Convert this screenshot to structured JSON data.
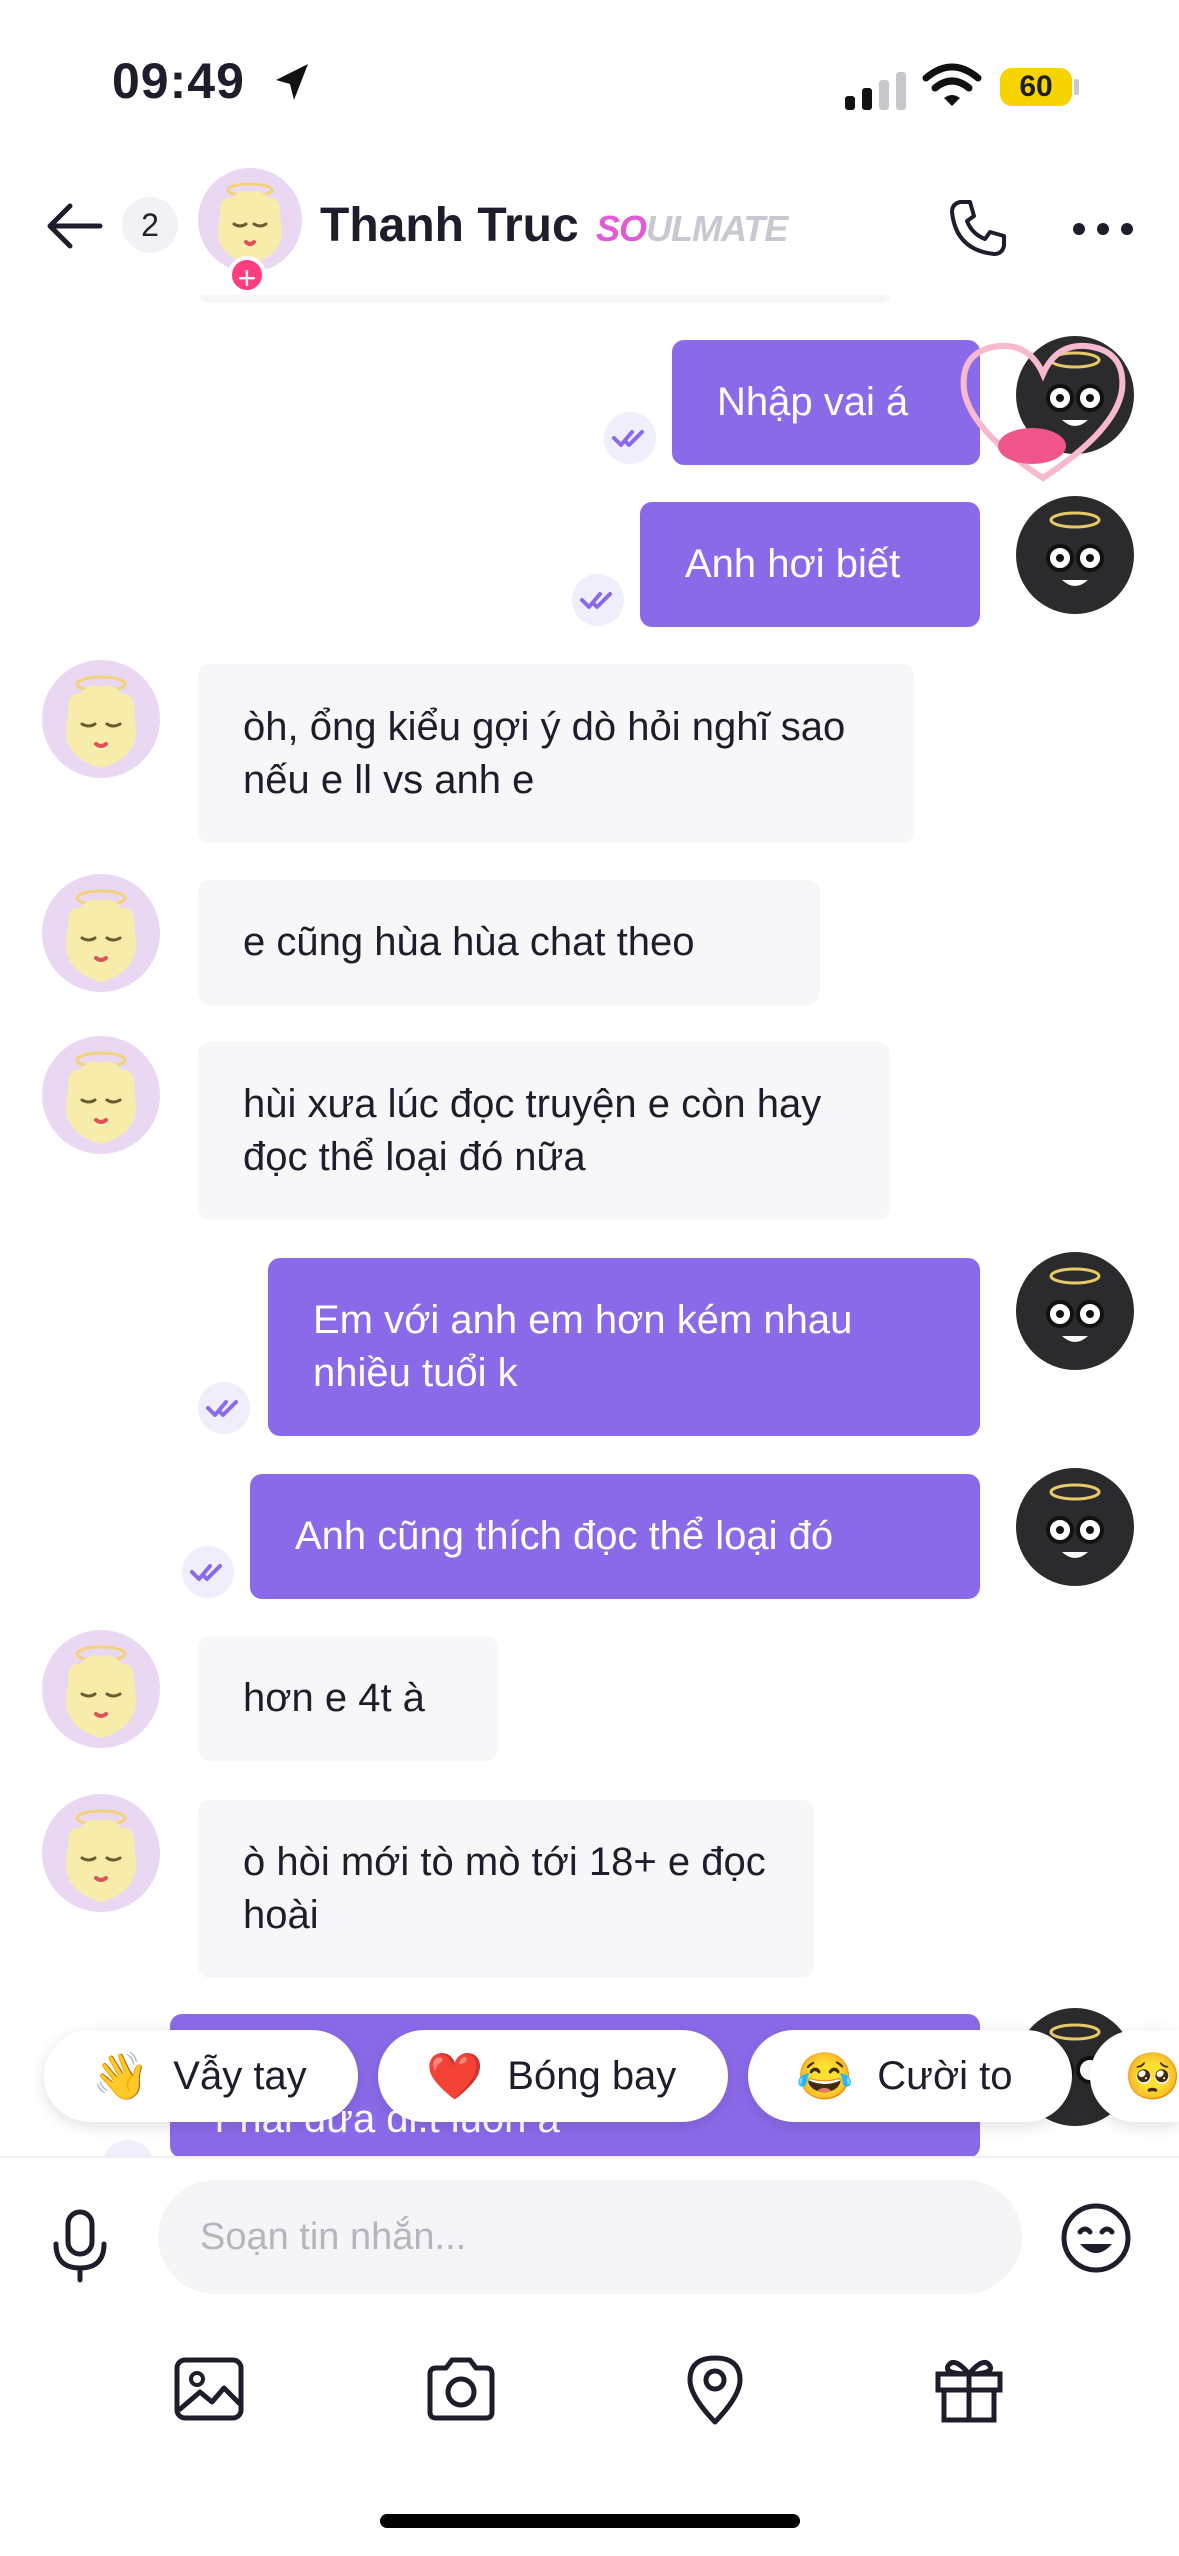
{
  "status_bar": {
    "time": "09:49",
    "battery": "60"
  },
  "header": {
    "back_count": "2",
    "contact_name": "Thanh Truc",
    "tag_so": "SO",
    "tag_rest": "ULMATE"
  },
  "messages": [
    {
      "from": "me",
      "text": "Nhập vai á"
    },
    {
      "from": "me",
      "text": "Anh hơi biết"
    },
    {
      "from": "her",
      "text": "òh, ổng kiểu gợi ý dò hỏi nghĩ sao nếu e ll vs anh e"
    },
    {
      "from": "her",
      "text": "e cũng hùa hùa chat theo"
    },
    {
      "from": "her",
      "text": "hùi xưa lúc đọc truyện e còn hay đọc thể loại đó nữa"
    },
    {
      "from": "me",
      "text": "Em với anh em hơn kém nhau nhiều tuổi k"
    },
    {
      "from": "me",
      "text": "Anh cũng thích đọc thể loại đó"
    },
    {
      "from": "her",
      "text": "hơn e 4t à"
    },
    {
      "from": "her",
      "text": "ò hòi mới tò mò tới 18+ e đọc hoài"
    },
    {
      "from": "me",
      "text": "r hai đứa đi.t luôn á"
    }
  ],
  "quick_reactions": [
    {
      "emoji": "👋",
      "label": "Vẫy tay"
    },
    {
      "emoji": "❤️",
      "label": "Bóng bay"
    },
    {
      "emoji": "😂",
      "label": "Cười to"
    },
    {
      "emoji": "🥺",
      "label": ""
    }
  ],
  "composer": {
    "placeholder": "Soạn tin nhắn..."
  },
  "icons": {
    "status": [
      "location-arrow-icon",
      "signal-icon",
      "wifi-icon",
      "battery-icon"
    ],
    "header": [
      "back-arrow-icon",
      "phone-icon",
      "more-icon"
    ],
    "toolbar": [
      "image-icon",
      "camera-icon",
      "location-pin-icon",
      "gift-icon"
    ]
  },
  "colors": {
    "outgoing_bubble": "#8b6ae9",
    "incoming_bubble": "#f7f7f9",
    "badge_pink": "#ff3d7f",
    "battery_yellow": "#f7d300"
  }
}
